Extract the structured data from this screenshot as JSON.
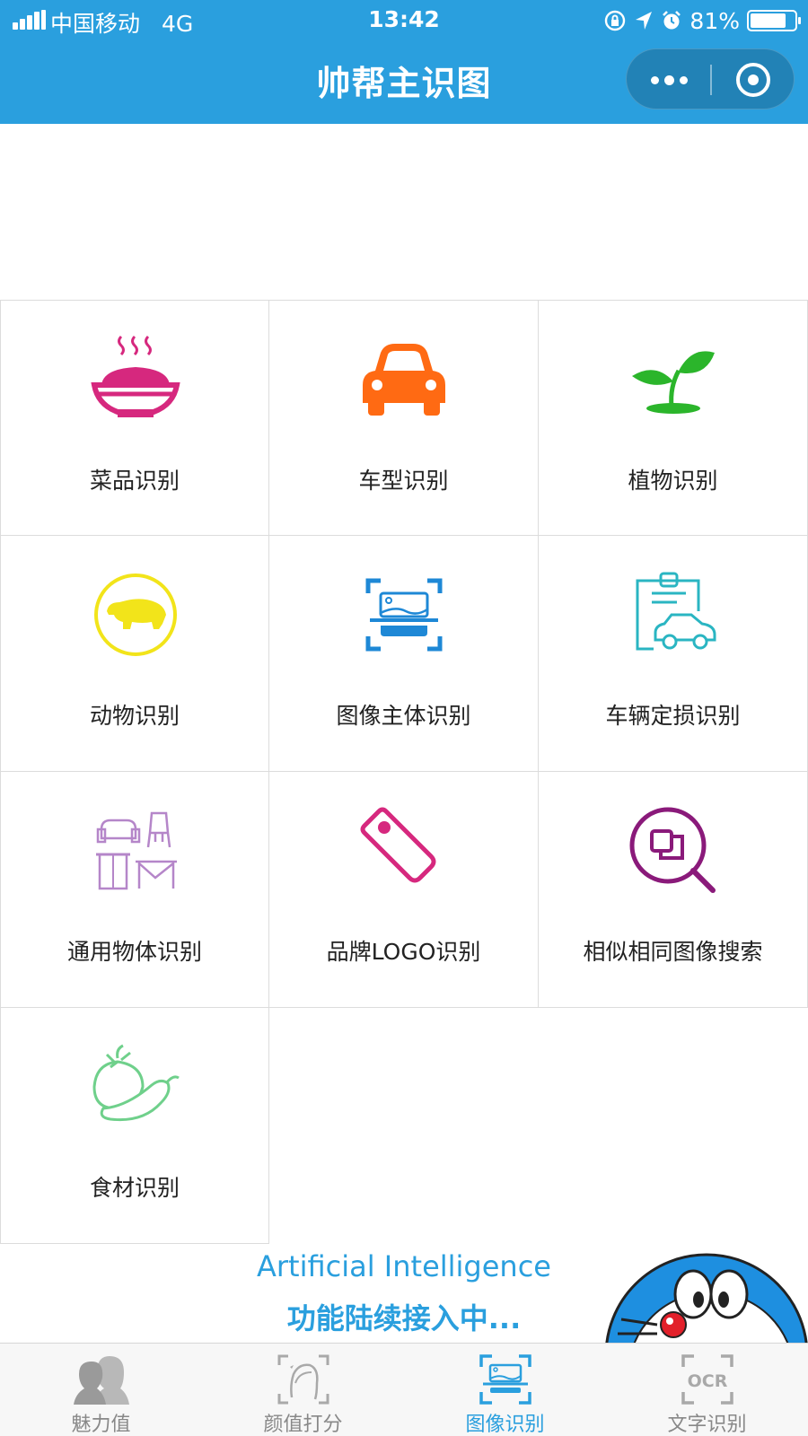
{
  "status": {
    "carrier": "中国移动",
    "network": "4G",
    "time": "13:42",
    "battery": "81%",
    "battery_level": 0.81
  },
  "nav": {
    "title": "帅帮主识图"
  },
  "grid": [
    {
      "label": "菜品识别",
      "icon": "dish-icon"
    },
    {
      "label": "车型识别",
      "icon": "car-icon"
    },
    {
      "label": "植物识别",
      "icon": "plant-sprout-icon"
    },
    {
      "label": "动物识别",
      "icon": "polar-bear-icon"
    },
    {
      "label": "图像主体识别",
      "icon": "image-scan-icon"
    },
    {
      "label": "车辆定损识别",
      "icon": "vehicle-damage-clipboard-icon"
    },
    {
      "label": "通用物体识别",
      "icon": "furniture-icon"
    },
    {
      "label": "品牌LOGO识别",
      "icon": "tag-icon"
    },
    {
      "label": "相似相同图像搜索",
      "icon": "image-search-icon"
    },
    {
      "label": "食材识别",
      "icon": "vegetables-icon"
    }
  ],
  "banner": {
    "english": "Artificial Intelligence",
    "chinese": "功能陆续接入中..."
  },
  "tabs": [
    {
      "label": "魅力值",
      "icon": "couple-silhouette-icon",
      "active": false
    },
    {
      "label": "颜值打分",
      "icon": "face-scan-icon",
      "active": false
    },
    {
      "label": "图像识别",
      "icon": "image-scan-icon",
      "active": true
    },
    {
      "label": "文字识别",
      "icon": "ocr-icon",
      "active": false
    }
  ],
  "colors": {
    "primary": "#2a9fde",
    "dish": "#d6287e",
    "car": "#ff6a13",
    "plant": "#2bb52b",
    "animal": "#f2e41a",
    "scan": "#1e88d6",
    "damage": "#2ab5c2",
    "furniture": "#b586c9",
    "tag": "#d6287e",
    "search": "#8a1a7a",
    "vegetables": "#6fd08b"
  }
}
